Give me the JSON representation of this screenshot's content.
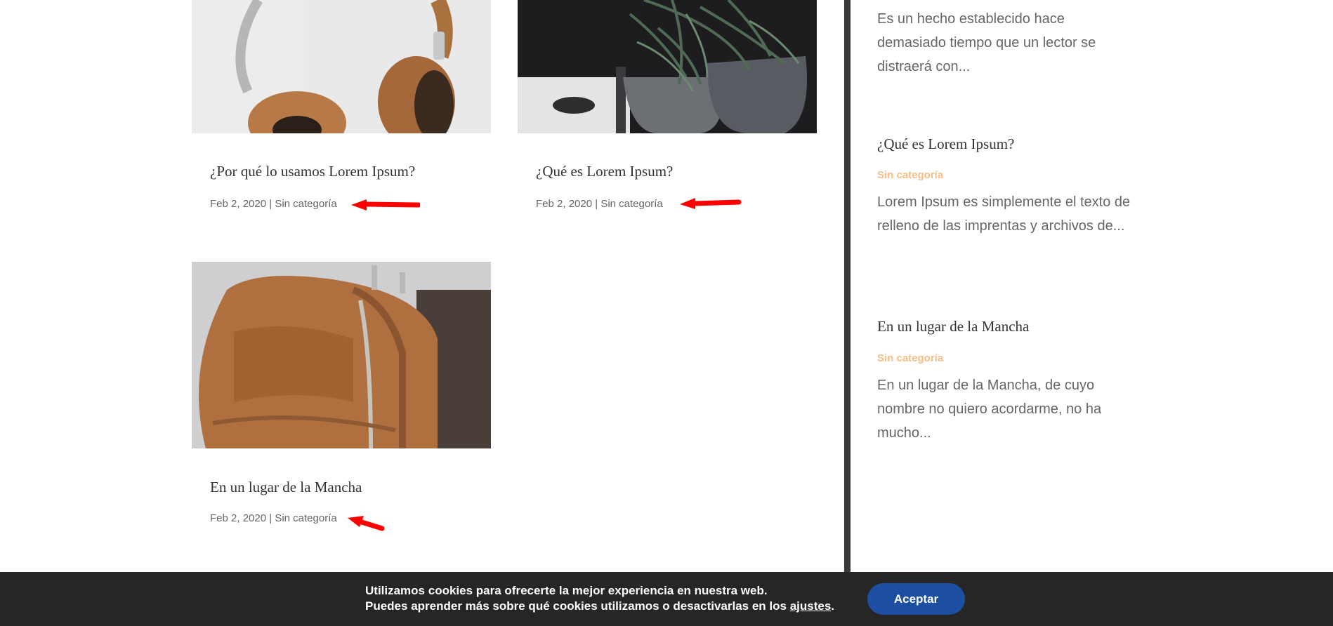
{
  "posts": [
    {
      "title": "¿Por qué lo usamos Lorem Ipsum?",
      "date": "Feb 2, 2020",
      "sep": "|",
      "category": "Sin categoría",
      "image": "headphones-photo"
    },
    {
      "title": "¿Qué es Lorem Ipsum?",
      "date": "Feb 2, 2020",
      "sep": "|",
      "category": "Sin categoría",
      "image": "plants-photo"
    },
    {
      "title": "En un lugar de la Mancha",
      "date": "Feb 2, 2020",
      "sep": "|",
      "category": "Sin categoría",
      "image": "leather-bag-photo"
    }
  ],
  "sidebar": {
    "top_excerpt": "Es un hecho establecido hace demasiado tiempo que un lector se distraerá con...",
    "items": [
      {
        "title": "¿Qué es Lorem Ipsum?",
        "category": "Sin categoría",
        "excerpt": "Lorem Ipsum es simplemente el texto de relleno de las imprentas y archivos de..."
      },
      {
        "title": "En un lugar de la Mancha",
        "category": "Sin categoría",
        "excerpt": "En un lugar de la Mancha, de cuyo nombre no quiero acordarme, no ha mucho..."
      }
    ]
  },
  "cookie": {
    "line1": "Utilizamos cookies para ofrecerte la mejor experiencia en nuestra web.",
    "line2_prefix": "Puedes aprender más sobre qué cookies utilizamos o desactivarlas en los ",
    "link": "ajustes",
    "line2_suffix": ".",
    "accept_label": "Aceptar"
  },
  "colors": {
    "category_accent": "#f6bd85",
    "accept_button": "#1c4fa1",
    "arrow": "#ff0000"
  },
  "annotations": "red-arrow-icon"
}
